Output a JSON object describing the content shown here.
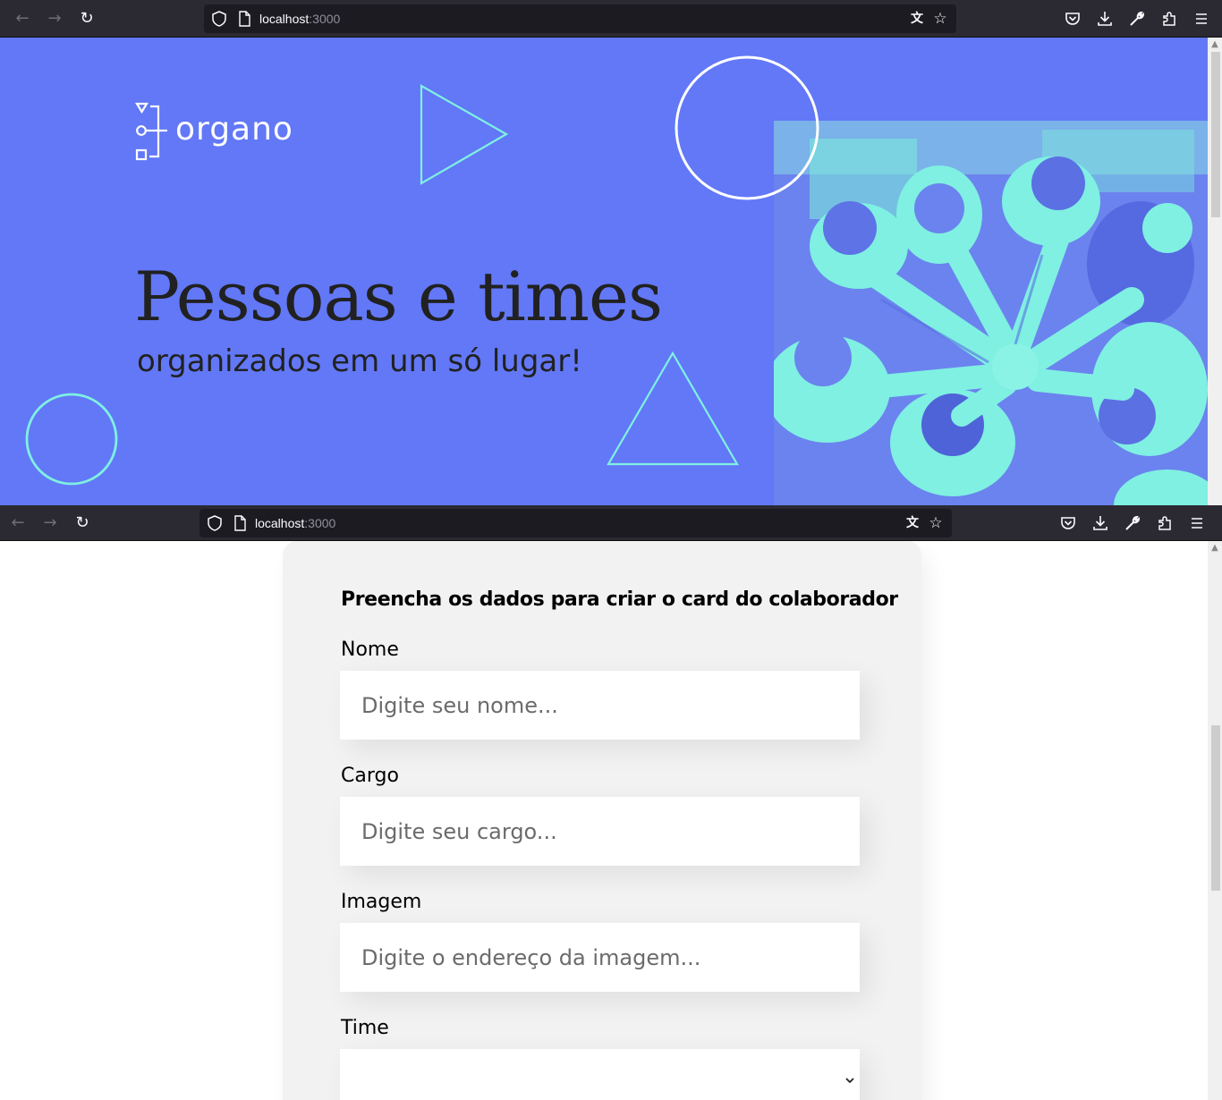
{
  "browser": {
    "url_host": "localhost",
    "url_port": ":3000",
    "icons": {
      "back": "back-arrow-icon",
      "forward": "forward-arrow-icon",
      "reload": "reload-icon",
      "translate": "translate-icon",
      "bookmark": "star-icon",
      "pocket": "pocket-icon",
      "downloads": "download-icon",
      "tools": "wrench-icon",
      "extensions": "puzzle-icon",
      "menu": "hamburger-menu-icon"
    }
  },
  "banner": {
    "logo_text": "organo",
    "title": "Pessoas e times",
    "subtitle": "organizados em um só lugar!",
    "colors": {
      "background": "#6278f7",
      "accent": "#7ff0e2",
      "text": "#212121"
    }
  },
  "form": {
    "title": "Preencha os dados para criar o card do colaborador",
    "fields": [
      {
        "label": "Nome",
        "placeholder": "Digite seu nome..."
      },
      {
        "label": "Cargo",
        "placeholder": "Digite seu cargo..."
      },
      {
        "label": "Imagem",
        "placeholder": "Digite o endereço da imagem..."
      }
    ],
    "select": {
      "label": "Time",
      "value": ""
    }
  }
}
